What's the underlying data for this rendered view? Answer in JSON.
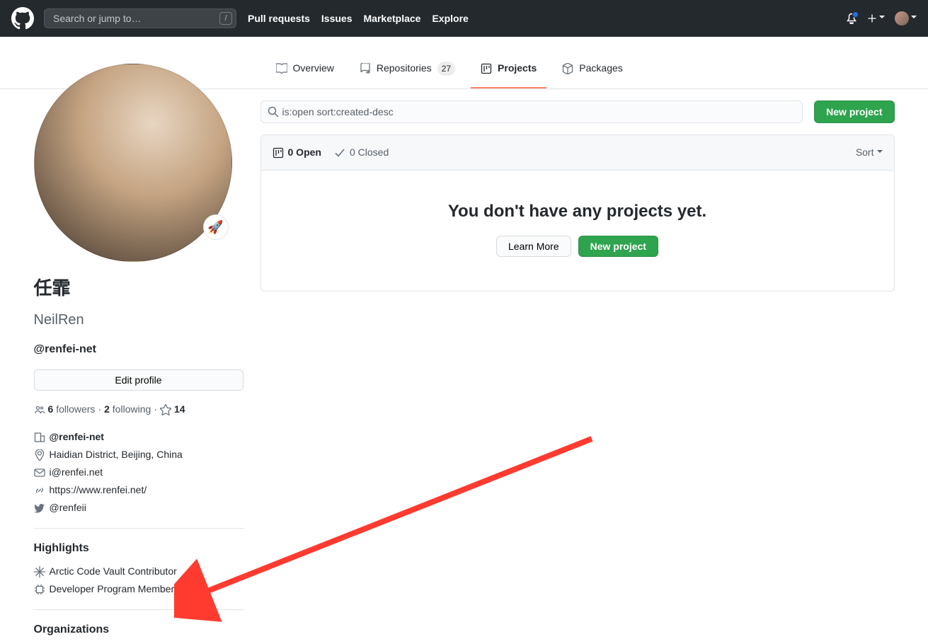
{
  "header": {
    "search_placeholder": "Search or jump to…",
    "nav": {
      "pull_requests": "Pull requests",
      "issues": "Issues",
      "marketplace": "Marketplace",
      "explore": "Explore"
    }
  },
  "tabs": {
    "overview": "Overview",
    "repositories": "Repositories",
    "repositories_count": "27",
    "projects": "Projects",
    "packages": "Packages"
  },
  "profile": {
    "status_emoji": "🚀",
    "fullname": "任霏",
    "username": "NeilRen",
    "bio": "@renfei-net",
    "edit_profile": "Edit profile",
    "followers_count": "6",
    "followers_label": "followers",
    "following_count": "2",
    "following_label": "following",
    "stars_count": "14",
    "org": "@renfei-net",
    "location": "Haidian District, Beijing, China",
    "email": "i@renfei.net",
    "website": "https://www.renfei.net/",
    "twitter": "@renfeii",
    "highlights_title": "Highlights",
    "highlight_arctic": "Arctic Code Vault Contributor",
    "highlight_dev": "Developer Program Member",
    "orgs_title": "Organizations"
  },
  "projects": {
    "filter_value": "is:open sort:created-desc",
    "new_project": "New project",
    "open_count": "0 Open",
    "closed_count": "0 Closed",
    "sort": "Sort",
    "blank_title": "You don't have any projects yet.",
    "learn_more": "Learn More"
  }
}
